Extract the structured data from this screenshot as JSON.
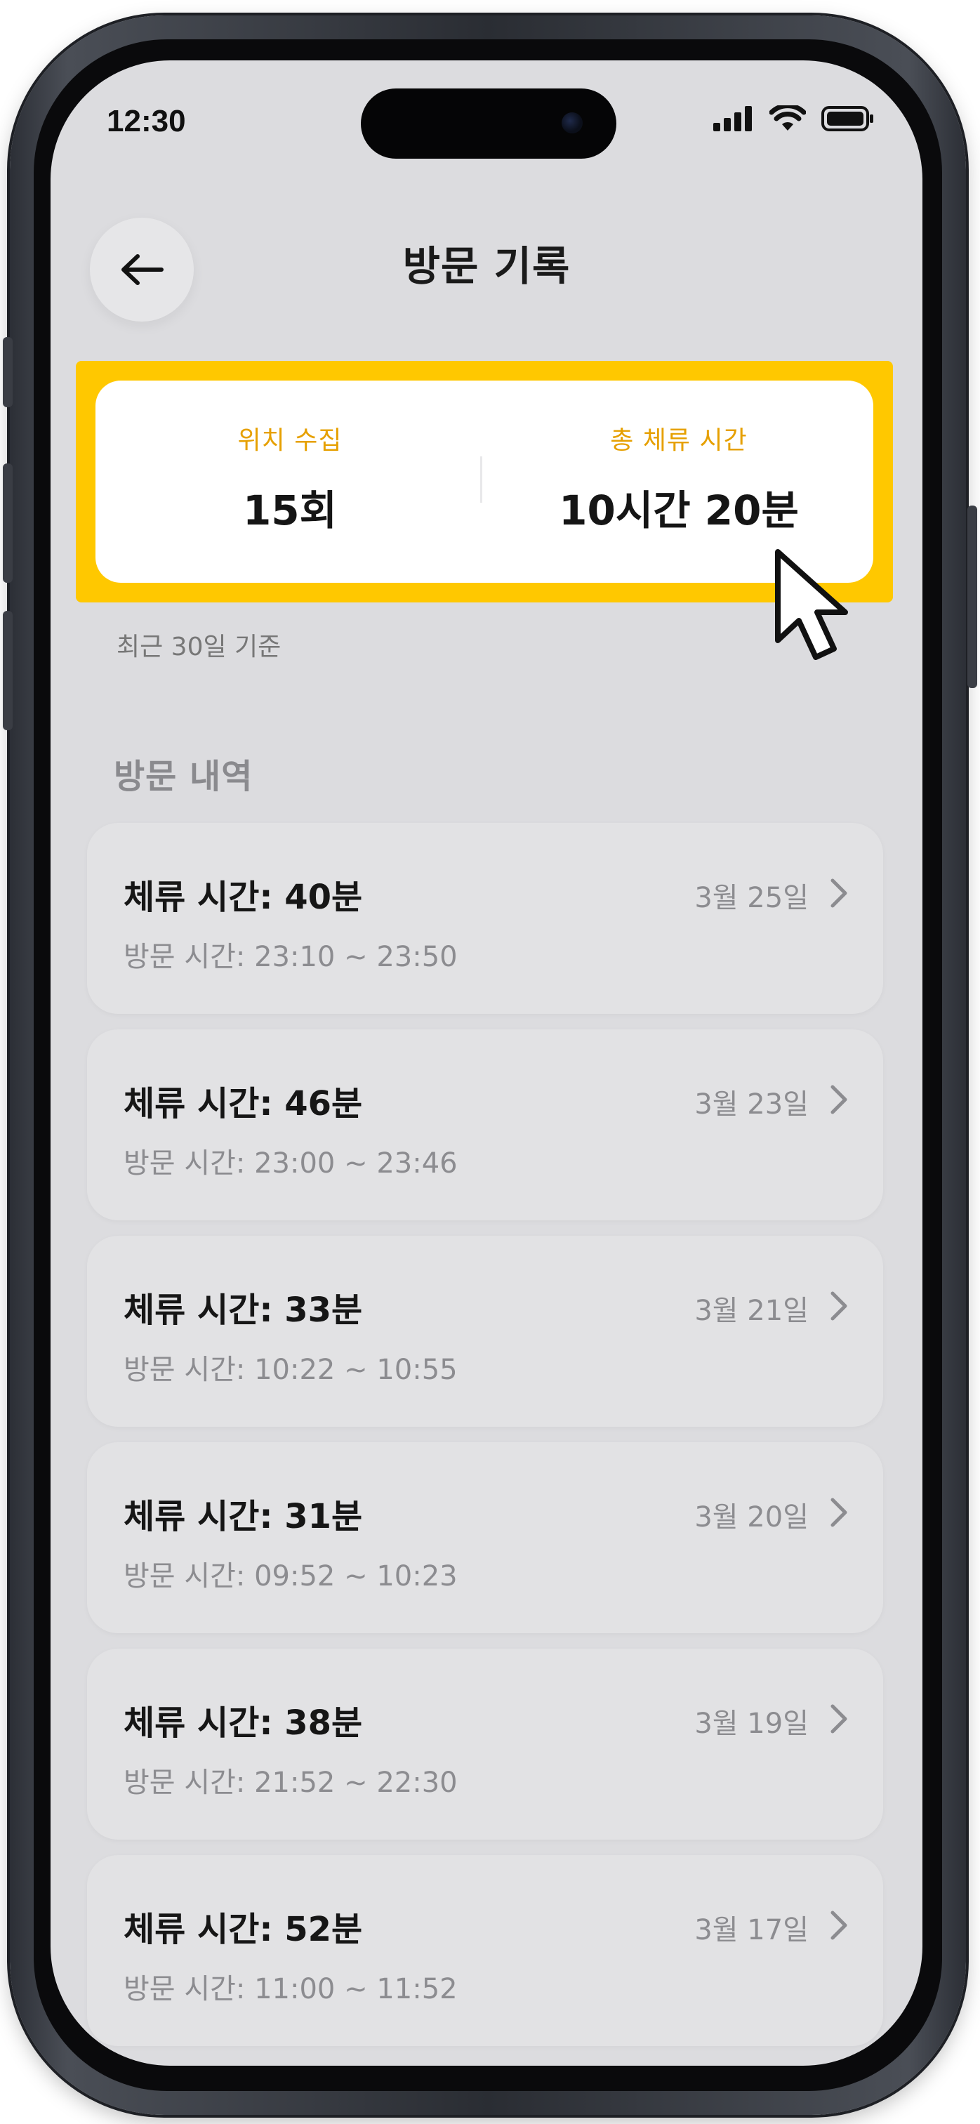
{
  "status_bar": {
    "time": "12:30"
  },
  "header": {
    "title": "방문 기록",
    "back_icon": "arrow-left-icon"
  },
  "summary": {
    "location_label": "위치 수집",
    "location_value": "15회",
    "stay_label": "총 체류 시간",
    "stay_value": "10시간 20분",
    "highlight_color": "#ffc800",
    "label_color": "#e6a000"
  },
  "basis_note": "최근 30일 기준",
  "visits_section": {
    "title": "방문 내역",
    "items": [
      {
        "duration": "체류 시간: 40분",
        "time": "방문 시간: 23:10 ~ 23:50",
        "date": "3월 25일"
      },
      {
        "duration": "체류 시간: 46분",
        "time": "방문 시간: 23:00 ~ 23:46",
        "date": "3월 23일"
      },
      {
        "duration": "체류 시간: 33분",
        "time": "방문 시간: 10:22 ~ 10:55",
        "date": "3월 21일"
      },
      {
        "duration": "체류 시간: 31분",
        "time": "방문 시간: 09:52 ~ 10:23",
        "date": "3월 20일"
      },
      {
        "duration": "체류 시간: 38분",
        "time": "방문 시간: 21:52 ~ 22:30",
        "date": "3월 19일"
      },
      {
        "duration": "체류 시간: 52분",
        "time": "방문 시간: 11:00 ~ 11:52",
        "date": "3월 17일"
      }
    ]
  }
}
